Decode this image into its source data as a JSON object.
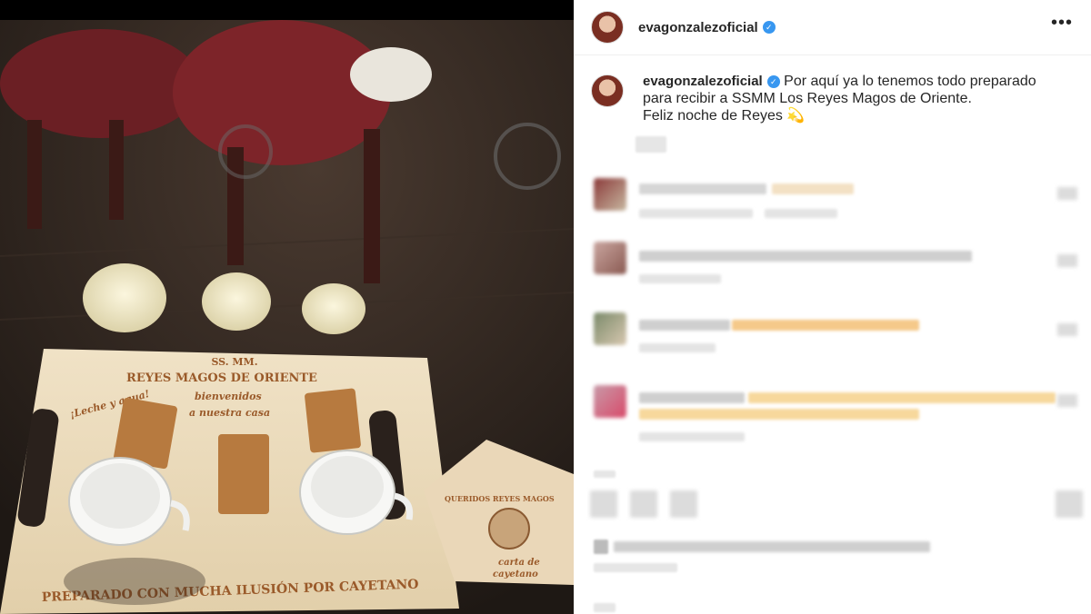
{
  "post": {
    "username": "evagonzalezoficial",
    "more_label": "•••",
    "caption_lines": [
      "Por aquí ya lo tenemos todo preparado",
      "para recibir a SSMM Los Reyes Magos de Oriente.",
      "Feliz noche de Reyes 💫"
    ]
  },
  "photo": {
    "tray_title": [
      "SS. MM.",
      "REYES MAGOS DE ORIENTE"
    ],
    "tray_left_note": "¡Leche y agua!",
    "tray_welcome": [
      "bienvenidos",
      "a nuestra casa"
    ],
    "tray_bottom": "PREPARADO CON MUCHA ILUSIÓN POR CAYETANO",
    "card_title": "QUERIDOS REYES MAGOS",
    "card_text": [
      "carta de",
      "cayetano"
    ]
  },
  "colors": {
    "verified": "#3897f0",
    "blur_highlight": "#f5c98a",
    "text": "#262626"
  }
}
